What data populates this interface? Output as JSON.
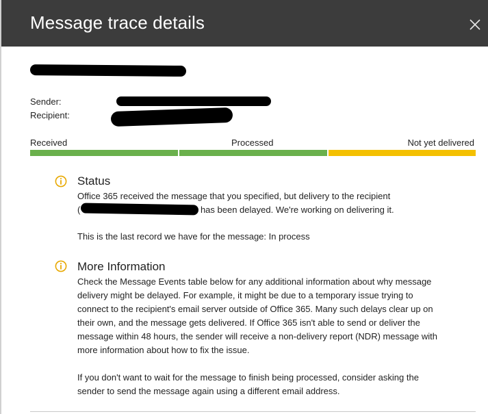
{
  "header": {
    "title": "Message trace details",
    "close_icon": "close-icon"
  },
  "fields": {
    "sender_label": "Sender:",
    "recipient_label": "Recipient:"
  },
  "progress": {
    "stages": [
      {
        "label": "Received",
        "status": "complete",
        "color": "#6ab04c"
      },
      {
        "label": "Processed",
        "status": "complete",
        "color": "#6ab04c"
      },
      {
        "label": "Not yet delivered",
        "status": "pending",
        "color": "#f4c000"
      }
    ]
  },
  "status": {
    "title": "Status",
    "icon": "info-icon",
    "line1": "Office 365 received the message that you specified, but delivery to the recipient",
    "line2_open": "(",
    "line2_rest": " has been delayed. We're working on delivering it.",
    "last_record": "This is the last record we have for the message: In process"
  },
  "more_info": {
    "title": "More Information",
    "icon": "info-icon",
    "lines": [
      "Check the Message Events table below for any additional information about why message",
      "delivery might be delayed. For example, it might be due to a temporary issue trying to",
      "connect to the recipient's email server outside of Office 365. Many such delays clear up on",
      "their own, and the message gets delivered. If Office 365 isn't able to send or deliver the",
      "message within 48 hours, the sender will receive a non-delivery report (NDR) message with",
      "more information about how to fix the issue."
    ],
    "lines2": [
      "If you don't want to wait for the message to finish being processed, consider asking the",
      "sender to send the message again using a different email address."
    ]
  },
  "colors": {
    "header_bg": "#3c3c3c",
    "complete": "#6ab04c",
    "pending": "#f4c000",
    "info_icon": "#e8a800"
  }
}
